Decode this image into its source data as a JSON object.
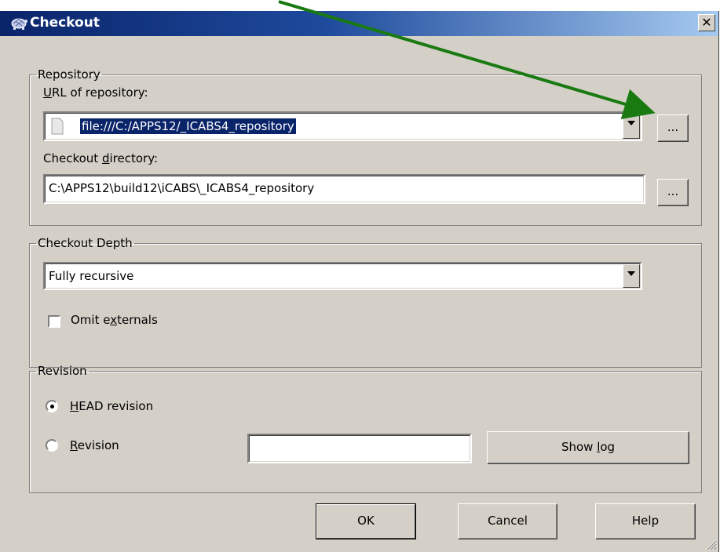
{
  "window": {
    "title": "Checkout"
  },
  "repository": {
    "legend": "Repository",
    "url_label_pre": "",
    "url_label_u": "U",
    "url_label_post": "RL of repository:",
    "url_value": "file:///C:/APPS12/_ICABS4_repository",
    "dir_label_pre": "Checkout ",
    "dir_label_u": "d",
    "dir_label_post": "irectory:",
    "dir_value": "C:\\APPS12\\build12\\iCABS\\_ICABS4_repository",
    "browse_label": "..."
  },
  "depth": {
    "legend": "Checkout Depth",
    "selected": "Fully recursive",
    "omit_pre": "Omit e",
    "omit_u": "x",
    "omit_post": "ternals",
    "omit_checked": false
  },
  "revision": {
    "legend": "Revision",
    "head_u": "H",
    "head_post": "EAD revision",
    "rev_u": "R",
    "rev_post": "evision",
    "rev_value": "",
    "showlog_pre": "Show ",
    "showlog_u": "l",
    "showlog_post": "og",
    "selected": "HEAD revision"
  },
  "buttons": {
    "ok": "OK",
    "cancel": "Cancel",
    "help": "Help"
  },
  "annotation": {
    "arrow_color": "#1a7a12"
  }
}
